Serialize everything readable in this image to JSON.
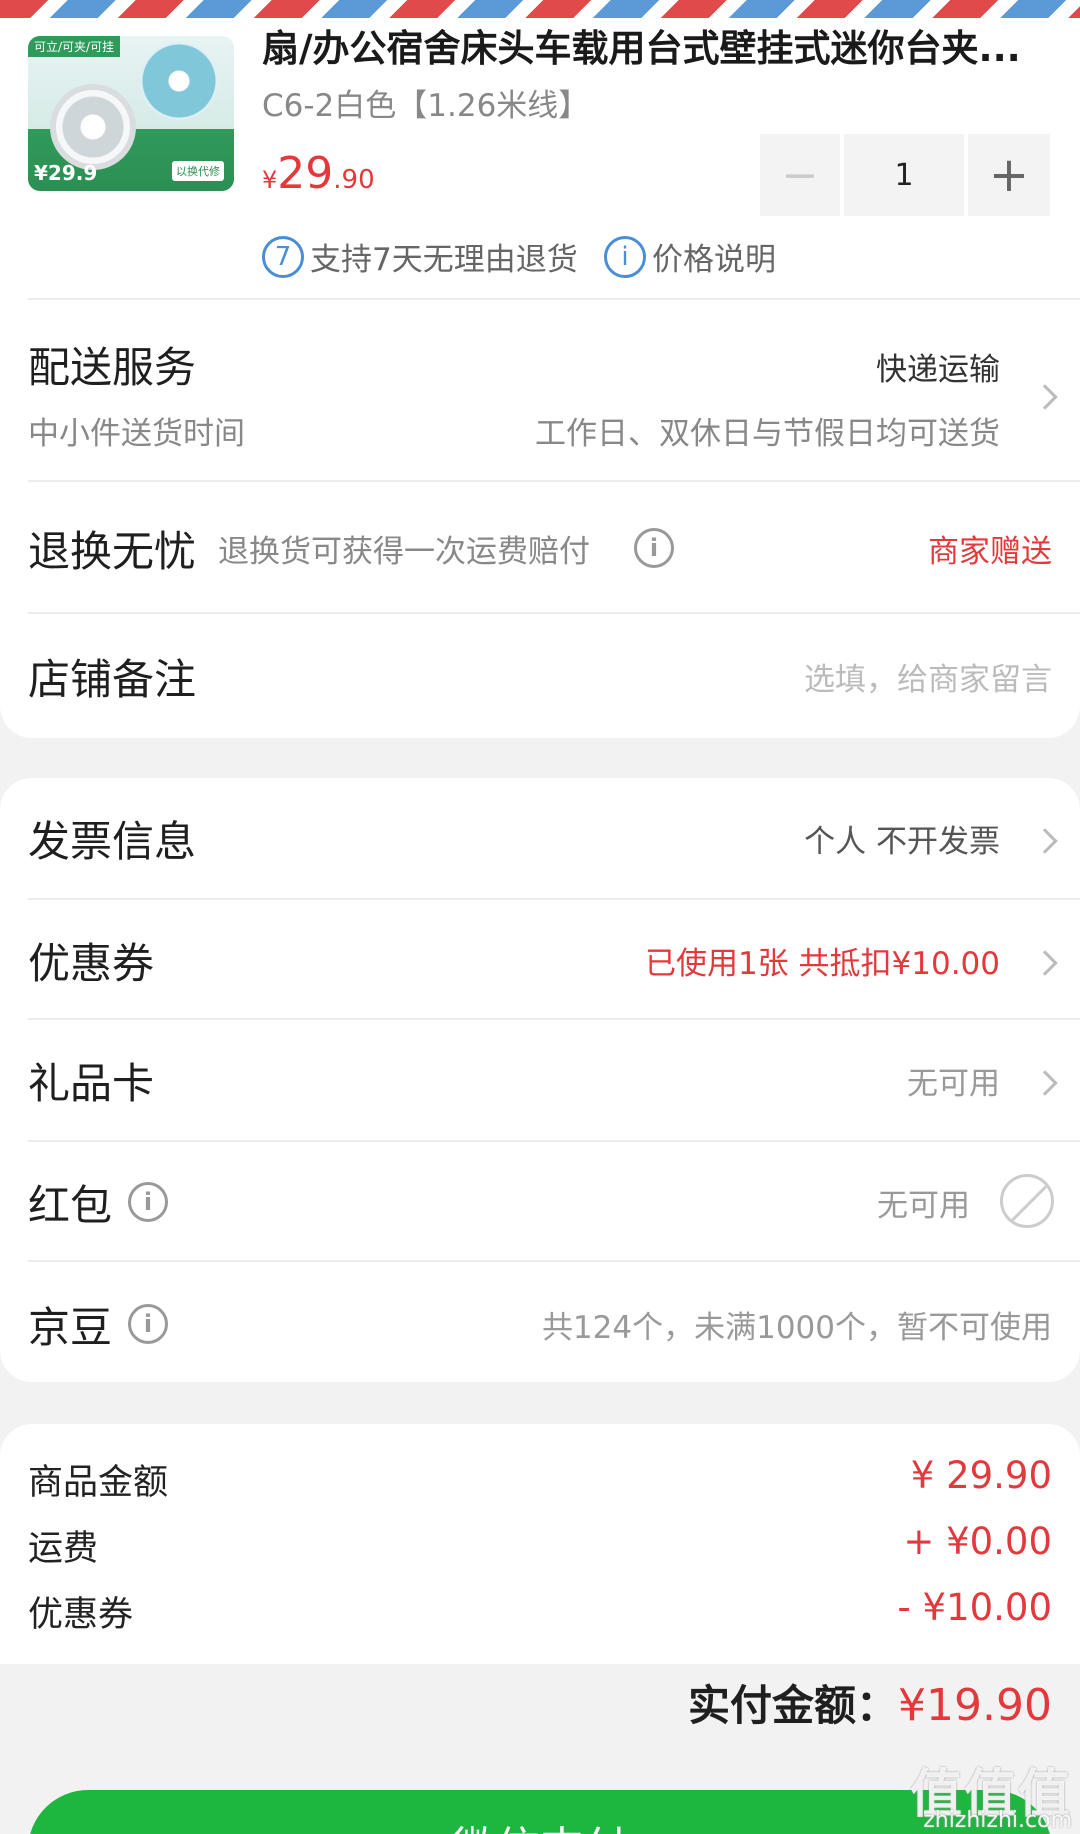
{
  "product": {
    "title": "扇/办公宿舍床头车载用台式壁挂式迷你台夹...",
    "spec": "C6-2白色【1.26米线】",
    "price_currency": "¥",
    "price_int": "29",
    "price_dec": ".90",
    "quantity": "1",
    "minus": "−",
    "plus": "+",
    "return_badge": "7",
    "return_text": "支持7天无理由退货",
    "price_info_text": "价格说明",
    "thumb_tag": "可立/可夹/可挂",
    "thumb_price": "¥29.9",
    "thumb_gift": "以换代修"
  },
  "delivery": {
    "label": "配送服务",
    "method": "快递运输",
    "sub_left": "中小件送货时间",
    "sub_right": "工作日、双休日与节假日均可送货"
  },
  "worry_free": {
    "label": "退换无忧",
    "desc": "退换货可获得一次运费赔付",
    "value": "商家赠送"
  },
  "note": {
    "label": "店铺备注",
    "placeholder": "选填，给商家留言"
  },
  "invoice": {
    "label": "发票信息",
    "value": "个人 不开发票"
  },
  "coupon": {
    "label": "优惠券",
    "value": "已使用1张 共抵扣¥10.00"
  },
  "gift_card": {
    "label": "礼品卡",
    "value": "无可用"
  },
  "red_packet": {
    "label": "红包",
    "value": "无可用"
  },
  "jingdou": {
    "label": "京豆",
    "value": "共124个，未满1000个，暂不可使用"
  },
  "summary": {
    "rows": [
      {
        "label": "商品金额",
        "value": "¥ 29.90"
      },
      {
        "label": "运费",
        "value": "+ ¥0.00"
      },
      {
        "label": "优惠券",
        "value": "- ¥10.00"
      }
    ],
    "total_label": "实付金额：",
    "total_value": "¥19.90"
  },
  "pay_button": "微信支付",
  "watermark": {
    "main": "值值值",
    "sub": "zhizhizhi.com"
  }
}
